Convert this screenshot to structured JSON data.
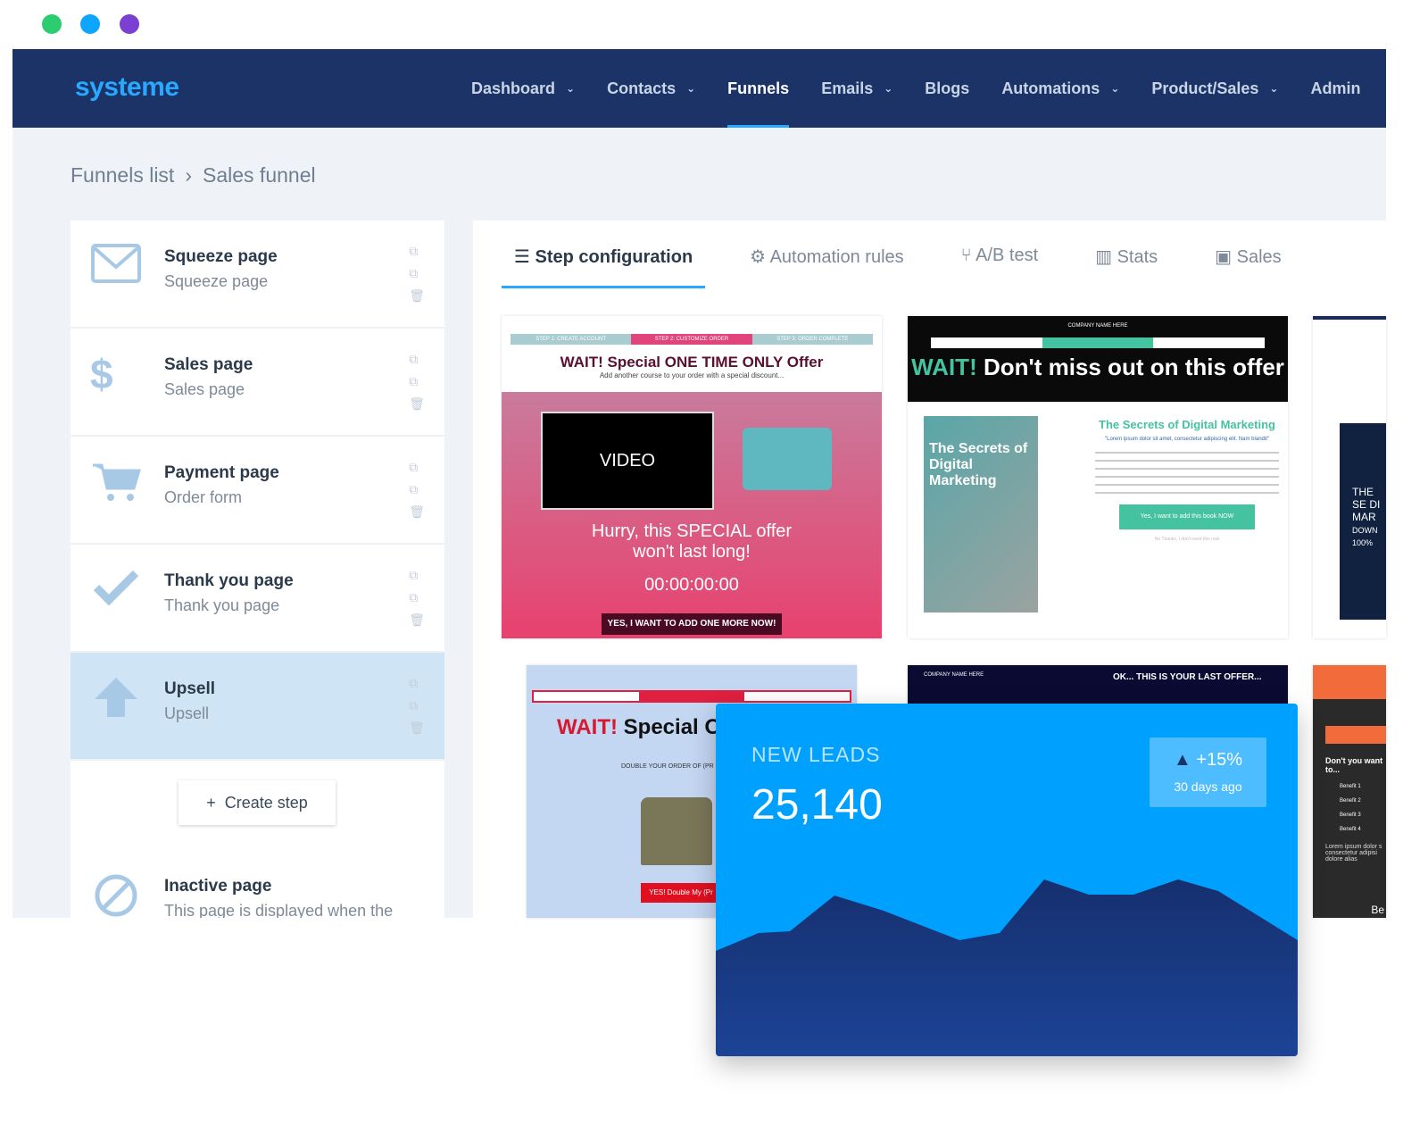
{
  "window": {
    "dots": [
      "#2ecc71",
      "#0ea5ff",
      "#7b3fd1"
    ]
  },
  "nav": {
    "logo": "systeme",
    "items": [
      {
        "label": "Dashboard",
        "dropdown": true
      },
      {
        "label": "Contacts",
        "dropdown": true
      },
      {
        "label": "Funnels",
        "active": true
      },
      {
        "label": "Emails",
        "dropdown": true
      },
      {
        "label": "Blogs"
      },
      {
        "label": "Automations",
        "dropdown": true
      },
      {
        "label": "Product/Sales",
        "dropdown": true
      },
      {
        "label": "Admin"
      }
    ]
  },
  "breadcrumb": {
    "parent": "Funnels list",
    "sep": "›",
    "current": "Sales funnel"
  },
  "steps": [
    {
      "title": "Squeeze page",
      "subtitle": "Squeeze page",
      "icon": "envelope-icon"
    },
    {
      "title": "Sales page",
      "subtitle": "Sales page",
      "icon": "dollar-icon"
    },
    {
      "title": "Payment page",
      "subtitle": "Order form",
      "icon": "cart-icon"
    },
    {
      "title": "Thank you page",
      "subtitle": "Thank you page",
      "icon": "check-icon"
    },
    {
      "title": "Upsell",
      "subtitle": "Upsell",
      "icon": "arrow-up-icon",
      "selected": true
    }
  ],
  "create_step": {
    "icon": "+",
    "label": "Create step"
  },
  "inactive": {
    "title": "Inactive page",
    "subtitle": "This page is displayed when the"
  },
  "tabs": [
    {
      "icon": "☰",
      "label": "Step configuration",
      "active": true
    },
    {
      "icon": "⚙",
      "label": "Automation rules"
    },
    {
      "icon": "⑂",
      "label": "A/B test"
    },
    {
      "icon": "▥",
      "label": "Stats"
    },
    {
      "icon": "▣",
      "label": "Sales"
    }
  ],
  "templates": [
    {
      "steps": [
        "STEP 1: CREATE ACCOUNT",
        "STEP 2: CUSTOMIZE ORDER",
        "STEP 3: ORDER COMPLETE"
      ],
      "heading": "WAIT!  Special ONE TIME ONLY Offer",
      "sub": "Add another course to your order with a special discount...",
      "video": "VIDEO",
      "hurry": "Hurry, this SPECIAL offer won't last long!",
      "timer": "00:00:00:00",
      "cta": "YES, I WANT TO ADD ONE MORE NOW!"
    },
    {
      "company": "COMPANY NAME HERE",
      "heading_accent": "WAIT!",
      "heading": "Don't miss out on this offer",
      "book": "The Secrets of Digital Marketing",
      "title": "The Secrets of Digital Marketing",
      "quote": "\"Lorem ipsum dolor sit amet, consectetur adipiscing elit. Nam blandit\"",
      "cta": "Yes, I want to add this book NOW",
      "decline": "No Thanks, I don't need this now"
    },
    {
      "text": "THE SE DI MAR",
      "down": "DOWN 100%"
    },
    {
      "heading_accent": "WAIT!",
      "heading": "Special ONE TI",
      "sub": "DOUBLE YOUR ORDER OF (PR",
      "cta": "YES! Double My (Pr"
    },
    {
      "company": "COMPANY NAME HERE",
      "heading": "OK... THIS IS YOUR LAST OFFER..."
    },
    {
      "heading": "Don't you want to...",
      "benefits": [
        "Benefit 1",
        "Benefit 2",
        "Benefit 3",
        "Benefit 4"
      ],
      "lorem": "Lorem ipsum dolor s consectetur adipisi dolore alias",
      "btn": "Be"
    }
  ],
  "leads": {
    "label": "NEW LEADS",
    "value": "25,140",
    "change": "+15%",
    "period": "30 days ago",
    "color": "#00a0ff",
    "area_color": "#1b3a8a"
  }
}
